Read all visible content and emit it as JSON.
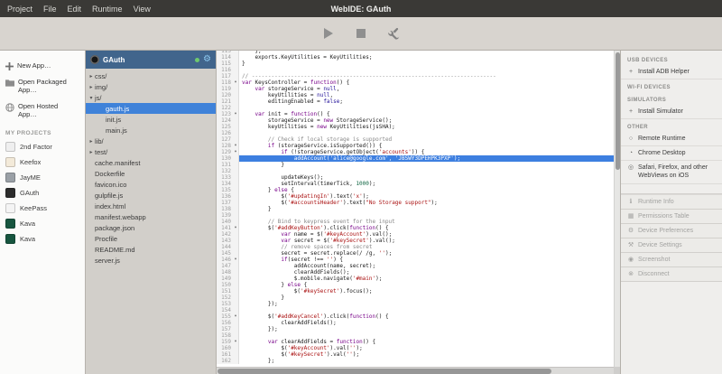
{
  "window": {
    "title": "WebIDE: GAuth"
  },
  "menubar": {
    "items": [
      "Project",
      "File",
      "Edit",
      "Runtime",
      "View"
    ]
  },
  "toolbar": {
    "buttons": [
      "play",
      "stop",
      "wrench"
    ]
  },
  "sidebar_left": {
    "actions": [
      {
        "icon": "plus",
        "label": "New App…"
      },
      {
        "icon": "folder",
        "label": "Open Packaged App…"
      },
      {
        "icon": "globe",
        "label": "Open Hosted App…"
      }
    ],
    "projects_header": "MY PROJECTS",
    "projects": [
      {
        "label": "2nd Factor",
        "color": "#efefef"
      },
      {
        "label": "Keefox",
        "color": "#f3ead9"
      },
      {
        "label": "JayME",
        "color": "#9aa0a6"
      },
      {
        "label": "GAuth",
        "color": "#2c2c2c"
      },
      {
        "label": "KeePass",
        "color": "#f4f4f4"
      },
      {
        "label": "Kava",
        "color": "#17553f"
      },
      {
        "label": "Kava",
        "color": "#17553f"
      }
    ]
  },
  "file_panel": {
    "header": {
      "title": "GAuth"
    },
    "tree": [
      {
        "label": "css/",
        "depth": 1,
        "twisty": "collapsed"
      },
      {
        "label": "img/",
        "depth": 1,
        "twisty": "collapsed"
      },
      {
        "label": "js/",
        "depth": 1,
        "twisty": "expanded"
      },
      {
        "label": "gauth.js",
        "depth": 2,
        "selected": true
      },
      {
        "label": "init.js",
        "depth": 2
      },
      {
        "label": "main.js",
        "depth": 2
      },
      {
        "label": "lib/",
        "depth": 1,
        "twisty": "collapsed"
      },
      {
        "label": "test/",
        "depth": 1,
        "twisty": "collapsed"
      },
      {
        "label": "cache.manifest",
        "depth": 1
      },
      {
        "label": "Dockerfile",
        "depth": 1
      },
      {
        "label": "favicon.ico",
        "depth": 1
      },
      {
        "label": "gulpfile.js",
        "depth": 1
      },
      {
        "label": "index.html",
        "depth": 1
      },
      {
        "label": "manifest.webapp",
        "depth": 1
      },
      {
        "label": "package.json",
        "depth": 1
      },
      {
        "label": "Procfile",
        "depth": 1
      },
      {
        "label": "README.md",
        "depth": 1
      },
      {
        "label": "server.js",
        "depth": 1
      }
    ]
  },
  "editor": {
    "file": "gauth.js",
    "first_line": 113,
    "highlighted_line": 130,
    "lines": [
      "    };",
      "    exports.KeyUtilities = KeyUtilities;",
      "}",
      "",
      "// ---------------------------------------------------------------------------",
      "var KeysController = function() {",
      "    var storageService = null,",
      "        keyUtilities = null,",
      "        editingEnabled = false;",
      "",
      "    var init = function() {",
      "        storageService = new StorageService();",
      "        keyUtilities = new KeyUtilities(jsSHA);",
      "",
      "        // Check if local storage is supported",
      "        if (storageService.isSupported()) {",
      "            if (!storageService.getObject('accounts')) {",
      "                addAccount('alice@google.com', 'JBSWY3DPEHPK3PXP');",
      "            }",
      "",
      "            updateKeys();",
      "            setInterval(timerTick, 1000);",
      "        } else {",
      "            $('#updatingIn').text('x');",
      "            $('#accountsHeader').text(\"No Storage support\");",
      "        }",
      "",
      "        // Bind to keypress event for the input",
      "        $('#addKeyButton').click(function() {",
      "            var name = $('#keyAccount').val();",
      "            var secret = $('#keySecret').val();",
      "            // remove spaces from secret",
      "            secret = secret.replace(/ /g, '');",
      "            if(secret !== '') {",
      "                addAccount(name, secret);",
      "                clearAddFields();",
      "                $.mobile.navigate('#main');",
      "            } else {",
      "                $('#keySecret').focus();",
      "            }",
      "        });",
      "",
      "        $('#addKeyCancel').click(function() {",
      "            clearAddFields();",
      "        });",
      "",
      "        var clearAddFields = function() {",
      "            $('#keyAccount').val('');",
      "            $('#keySecret').val('');",
      "        };"
    ]
  },
  "sidebar_right": {
    "sections": [
      {
        "header": "USB DEVICES",
        "items": [
          {
            "icon": "plus",
            "label": "Install ADB Helper"
          }
        ]
      },
      {
        "header": "WI-FI DEVICES",
        "items": []
      },
      {
        "header": "SIMULATORS",
        "items": [
          {
            "icon": "plus",
            "label": "Install Simulator"
          }
        ]
      },
      {
        "header": "OTHER",
        "items": [
          {
            "icon": "globe",
            "label": "Remote Runtime"
          },
          {
            "icon": "chrome",
            "label": "Chrome Desktop"
          },
          {
            "icon": "safari",
            "label": "Safari, Firefox, and other WebViews on iOS"
          }
        ]
      }
    ],
    "device_actions": [
      {
        "icon": "info",
        "label": "Runtime Info",
        "disabled": true
      },
      {
        "icon": "table",
        "label": "Permissions Table",
        "disabled": true
      },
      {
        "icon": "gear",
        "label": "Device Preferences",
        "disabled": true
      },
      {
        "icon": "wrench",
        "label": "Device Settings",
        "disabled": true
      },
      {
        "icon": "camera",
        "label": "Screenshot",
        "disabled": true
      },
      {
        "icon": "plug",
        "label": "Disconnect",
        "disabled": true
      }
    ]
  },
  "colors": {
    "selection_blue": "#3f82d9",
    "line_highlight_blue": "#3d7fe0",
    "panel_header_blue": "#41658c",
    "status_green": "#6ec96e"
  }
}
